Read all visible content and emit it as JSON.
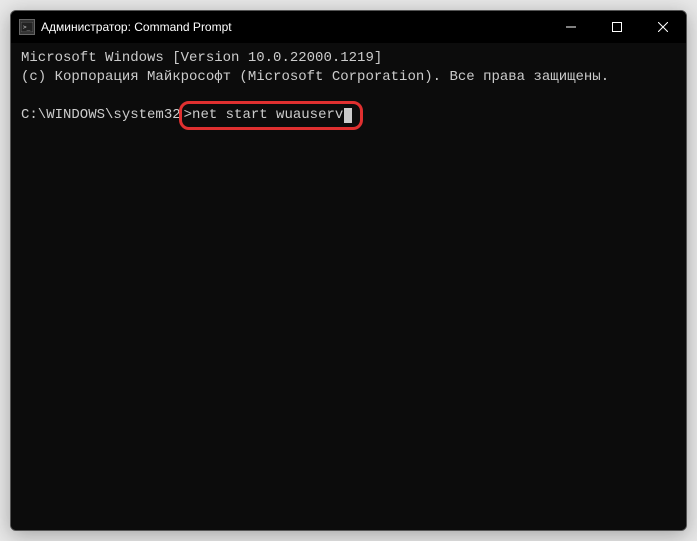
{
  "titlebar": {
    "icon_label": "cmd-icon",
    "title": "Администратор: Command Prompt"
  },
  "terminal": {
    "line1": "Microsoft Windows [Version 10.0.22000.1219]",
    "line2": "(c) Корпорация Майкрософт (Microsoft Corporation). Все права защищены.",
    "prompt": "C:\\WINDOWS\\system32",
    "prompt_sep": ">",
    "command": "net start wuauserv"
  }
}
